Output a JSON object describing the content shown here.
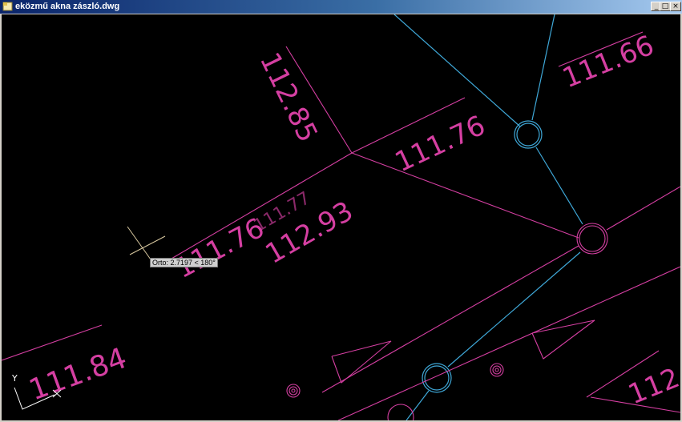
{
  "window": {
    "title": "eközmű akna zászló.dwg",
    "buttons": {
      "minimize": "_",
      "maximize": "□",
      "close": "×"
    }
  },
  "colors": {
    "background": "#000000",
    "magenta": "#d53fa2",
    "cyan": "#3fa8d8",
    "crosshair": "#d9c9a0"
  },
  "elevations": {
    "e1": "112.85",
    "e2": "111.76",
    "e3": "111.66",
    "e4": "111.76",
    "e5": "112.93",
    "e6": "111.77",
    "e7": "111.84",
    "e8": "112"
  },
  "tooltip": "Orto: 2.7197 < 180°",
  "ucs": {
    "x_label": "X",
    "y_label": "Y"
  }
}
